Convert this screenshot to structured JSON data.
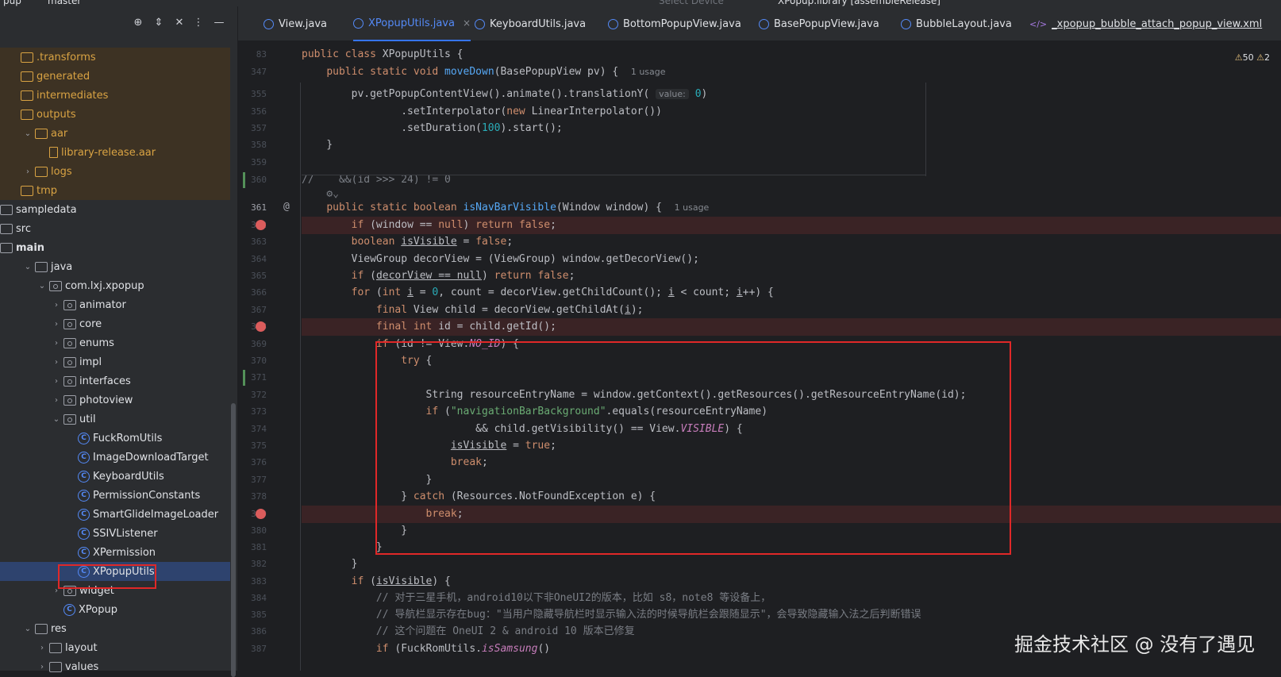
{
  "topbar": {
    "project": "pup",
    "branch": "master",
    "device": "Select Device",
    "run_config": "XPopup.library [assembleRelease]"
  },
  "project_panel": {
    "tree": [
      {
        "label": ".transforms",
        "indent": 0,
        "icon": "folder",
        "arrow": "",
        "excluded": true
      },
      {
        "label": "generated",
        "indent": 0,
        "icon": "folder",
        "arrow": "",
        "excluded": true
      },
      {
        "label": "intermediates",
        "indent": 0,
        "icon": "folder",
        "arrow": "",
        "excluded": true
      },
      {
        "label": "outputs",
        "indent": 0,
        "icon": "folder",
        "arrow": "",
        "excluded": true
      },
      {
        "label": "aar",
        "indent": 1,
        "icon": "folder",
        "arrow": "v",
        "excluded": true
      },
      {
        "label": "library-release.aar",
        "indent": 2,
        "icon": "aar",
        "arrow": "",
        "excluded": true
      },
      {
        "label": "logs",
        "indent": 1,
        "icon": "folder",
        "arrow": ">",
        "excluded": true
      },
      {
        "label": "tmp",
        "indent": 0,
        "icon": "folder",
        "arrow": "",
        "excluded": true
      },
      {
        "label": "sampledata",
        "indent": -1,
        "icon": "folder",
        "arrow": "",
        "excluded": false
      },
      {
        "label": "src",
        "indent": -1,
        "icon": "folder",
        "arrow": "",
        "excluded": false
      },
      {
        "label": "main",
        "indent": -1,
        "icon": "folder",
        "arrow": "",
        "excluded": false,
        "bold": true
      },
      {
        "label": "java",
        "indent": 1,
        "icon": "folder",
        "arrow": "v",
        "excluded": false
      },
      {
        "label": "com.lxj.xpopup",
        "indent": 2,
        "icon": "pkg",
        "arrow": "v",
        "excluded": false
      },
      {
        "label": "animator",
        "indent": 3,
        "icon": "pkg",
        "arrow": ">",
        "excluded": false
      },
      {
        "label": "core",
        "indent": 3,
        "icon": "pkg",
        "arrow": ">",
        "excluded": false
      },
      {
        "label": "enums",
        "indent": 3,
        "icon": "pkg",
        "arrow": ">",
        "excluded": false
      },
      {
        "label": "impl",
        "indent": 3,
        "icon": "pkg",
        "arrow": ">",
        "excluded": false
      },
      {
        "label": "interfaces",
        "indent": 3,
        "icon": "pkg",
        "arrow": ">",
        "excluded": false
      },
      {
        "label": "photoview",
        "indent": 3,
        "icon": "pkg",
        "arrow": ">",
        "excluded": false
      },
      {
        "label": "util",
        "indent": 3,
        "icon": "pkg",
        "arrow": "v",
        "excluded": false
      },
      {
        "label": "FuckRomUtils",
        "indent": 4,
        "icon": "cls",
        "arrow": "",
        "excluded": false
      },
      {
        "label": "ImageDownloadTarget",
        "indent": 4,
        "icon": "cls",
        "arrow": "",
        "excluded": false
      },
      {
        "label": "KeyboardUtils",
        "indent": 4,
        "icon": "cls",
        "arrow": "",
        "excluded": false
      },
      {
        "label": "PermissionConstants",
        "indent": 4,
        "icon": "cls",
        "arrow": "",
        "excluded": false
      },
      {
        "label": "SmartGlideImageLoader",
        "indent": 4,
        "icon": "cls",
        "arrow": "",
        "excluded": false
      },
      {
        "label": "SSIVListener",
        "indent": 4,
        "icon": "cls",
        "arrow": "",
        "excluded": false
      },
      {
        "label": "XPermission",
        "indent": 4,
        "icon": "cls",
        "arrow": "",
        "excluded": false
      },
      {
        "label": "XPopupUtils",
        "indent": 4,
        "icon": "cls",
        "arrow": "",
        "excluded": false,
        "selected": true
      },
      {
        "label": "widget",
        "indent": 3,
        "icon": "pkg",
        "arrow": ">",
        "excluded": false
      },
      {
        "label": "XPopup",
        "indent": 3,
        "icon": "cls",
        "arrow": "",
        "excluded": false
      },
      {
        "label": "res",
        "indent": 1,
        "icon": "folder",
        "arrow": "v",
        "excluded": false
      },
      {
        "label": "layout",
        "indent": 2,
        "icon": "folder",
        "arrow": ">",
        "excluded": false
      },
      {
        "label": "values",
        "indent": 2,
        "icon": "folder",
        "arrow": ">",
        "excluded": false
      }
    ]
  },
  "tabs": [
    {
      "label": "View.java",
      "active": false
    },
    {
      "label": "XPopupUtils.java",
      "active": true,
      "close": "×"
    },
    {
      "label": "KeyboardUtils.java",
      "active": false
    },
    {
      "label": "BottomPopupView.java",
      "active": false
    },
    {
      "label": "BasePopupView.java",
      "active": false
    },
    {
      "label": "BubbleLayout.java",
      "active": false
    },
    {
      "label": "_xpopup_bubble_attach_popup_view.xml",
      "active": false,
      "xml": true
    }
  ],
  "inspections": {
    "warnings": "50",
    "weak_warnings": "2"
  },
  "editor": {
    "lines": [
      {
        "n": "83",
        "html": "<span class=\"kw\">public class</span> XPopupUtils {"
      },
      {
        "n": "347",
        "html": "    <span class=\"kw\">public static void</span> <span class=\"fn\">moveDown</span>(BasePopupView pv) {  <span class=\"usage\">1 usage</span>"
      },
      {
        "n": "355",
        "html": "        pv.getPopupContentView().animate().translationY( <span class=\"hint\">value:</span> <span class=\"num\">0</span>)"
      },
      {
        "n": "356",
        "html": "                .setInterpolator(<span class=\"kw\">new</span> LinearInterpolator())"
      },
      {
        "n": "357",
        "html": "                .setDuration(<span class=\"num\">100</span>).start();"
      },
      {
        "n": "358",
        "html": "    }"
      },
      {
        "n": "359",
        "html": ""
      },
      {
        "n": "360",
        "html": "<span class=\"cmt\">//    &amp;&amp;(id &gt;&gt;&gt; 24) != 0</span>"
      },
      {
        "n": "",
        "html": "    <span class=\"cmt\">⚙⌄</span>"
      },
      {
        "n": "361",
        "html": "    <span class=\"kw\">public static boolean</span> <span class=\"fn\">isNavBarVisible</span>(Window window) {  <span class=\"usage\">1 usage</span>"
      },
      {
        "n": "362",
        "html": "        <span class=\"kw\">if</span> (window == <span class=\"kw\">null</span>) <span class=\"kw\">return false</span>;",
        "bp": true
      },
      {
        "n": "363",
        "html": "        <span class=\"kw\">boolean</span> <span class=\"ul\">isVisible</span> = <span class=\"kw\">false</span>;"
      },
      {
        "n": "364",
        "html": "        ViewGroup decorView = (ViewGroup) window.getDecorView();"
      },
      {
        "n": "365",
        "html": "        <span class=\"kw\">if</span> (<span class=\"ul\">decorView == null</span>) <span class=\"kw\">return false</span>;"
      },
      {
        "n": "366",
        "html": "        <span class=\"kw\">for</span> (<span class=\"kw\">int</span> <span class=\"ul\">i</span> = <span class=\"num\">0</span>, count = decorView.getChildCount(); <span class=\"ul\">i</span> &lt; count; <span class=\"ul\">i</span>++) {"
      },
      {
        "n": "367",
        "html": "            <span class=\"kw\">final</span> View child = decorView.getChildAt(<span class=\"ul\">i</span>);"
      },
      {
        "n": "368",
        "html": "            <span class=\"kw\">final int</span> id = child.getId();",
        "bp": true
      },
      {
        "n": "369",
        "html": "            <span class=\"kw\">if</span> (id != View.<span class=\"it\">NO_ID</span>) {"
      },
      {
        "n": "370",
        "html": "                <span class=\"kw\">try</span> {"
      },
      {
        "n": "371",
        "html": ""
      },
      {
        "n": "372",
        "html": "                    String resourceEntryName = window.getContext().getResources().getResourceEntryName(id);"
      },
      {
        "n": "373",
        "html": "                    <span class=\"kw\">if</span> (<span class=\"str\">\"navigationBarBackground\"</span>.equals(resourceEntryName)"
      },
      {
        "n": "374",
        "html": "                            &amp;&amp; child.getVisibility() == View.<span class=\"it\">VISIBLE</span>) {"
      },
      {
        "n": "375",
        "html": "                        <span class=\"ul\">isVisible</span> = <span class=\"kw\">true</span>;"
      },
      {
        "n": "376",
        "html": "                        <span class=\"kw\">break</span>;"
      },
      {
        "n": "377",
        "html": "                    }"
      },
      {
        "n": "378",
        "html": "                } <span class=\"kw\">catch</span> (Resources.NotFoundException e) {"
      },
      {
        "n": "379",
        "html": "                    <span class=\"kw\">break</span>;",
        "bp": true
      },
      {
        "n": "380",
        "html": "                }"
      },
      {
        "n": "381",
        "html": "            }"
      },
      {
        "n": "382",
        "html": "        }"
      },
      {
        "n": "383",
        "html": "        <span class=\"kw\">if</span> (<span class=\"ul\">isVisible</span>) {"
      },
      {
        "n": "384",
        "html": "            <span class=\"cmt\">// 对于三星手机，android10以下非OneUI2的版本，比如 s8，note8 等设备上，</span>"
      },
      {
        "n": "385",
        "html": "            <span class=\"cmt\">// 导航栏显示存在bug：\"当用户隐藏导航栏时显示输入法的时候导航栏会跟随显示\"，会导致隐藏输入法之后判断错误</span>"
      },
      {
        "n": "386",
        "html": "            <span class=\"cmt\">// 这个问题在 OneUI 2 &amp; android 10 版本已修复</span>"
      },
      {
        "n": "387",
        "html": "            <span class=\"kw\">if</span> (FuckRomUtils.<span class=\"it\">isSamsung</span>()"
      }
    ]
  },
  "watermark": "掘金技术社区 @ 没有了遇见"
}
